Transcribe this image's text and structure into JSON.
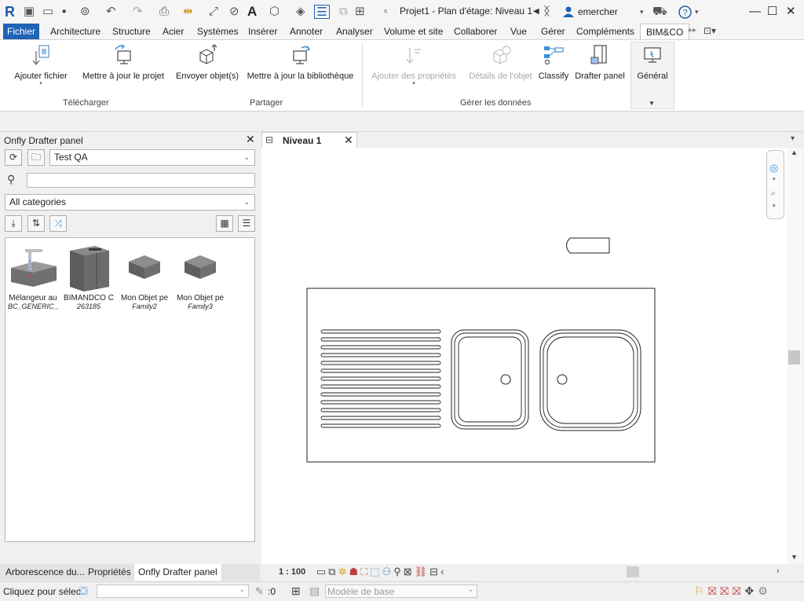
{
  "titlebar": {
    "title": "Projet1 - Plan d'étage: Niveau 1",
    "user": "emercher",
    "text_tool": "A",
    "app_logo": "R"
  },
  "tabs": [
    {
      "label": "Fichier"
    },
    {
      "label": "Architecture"
    },
    {
      "label": "Structure"
    },
    {
      "label": "Acier"
    },
    {
      "label": "Systèmes"
    },
    {
      "label": "Insérer"
    },
    {
      "label": "Annoter"
    },
    {
      "label": "Analyser"
    },
    {
      "label": "Volume et site"
    },
    {
      "label": "Collaborer"
    },
    {
      "label": "Vue"
    },
    {
      "label": "Gérer"
    },
    {
      "label": "Compléments"
    },
    {
      "label": "BIM&CO"
    }
  ],
  "ribbon": {
    "buttons": [
      {
        "label": "Ajouter fichier"
      },
      {
        "label": "Mettre à jour le projet"
      },
      {
        "label": "Envoyer objet(s)"
      },
      {
        "label": "Mettre à jour la bibliothèque"
      },
      {
        "label": "Ajouter des propriétés"
      },
      {
        "label": "Détails de l'objet"
      },
      {
        "label": "Classify"
      },
      {
        "label": "Drafter panel"
      },
      {
        "label": "Général"
      }
    ],
    "groups": [
      {
        "label": "Télécharger"
      },
      {
        "label": "Partager"
      },
      {
        "label": "Gérer les données"
      }
    ]
  },
  "left_panel": {
    "title": "Onfly Drafter panel",
    "close": "✕",
    "project_select": "Test QA",
    "search_value": "",
    "category_select": "All categories",
    "objects": [
      {
        "name": "Mélangeur au",
        "sub": "BC_GENERIC_A"
      },
      {
        "name": "BIMANDCO C",
        "sub": "263185"
      },
      {
        "name": "Mon Objet pe",
        "sub": "Family2"
      },
      {
        "name": "Mon Objet pe",
        "sub": "Family3"
      }
    ],
    "bottom_tabs": [
      {
        "label": "Arborescence du..."
      },
      {
        "label": "Propriétés"
      },
      {
        "label": "Onfly Drafter panel"
      }
    ]
  },
  "view": {
    "tab_label": "Niveau 1",
    "close": "✕",
    "scale": "1 : 100"
  },
  "status": {
    "prompt": "Cliquez pour sélec",
    "count": ":0",
    "model": "Modèle de base"
  },
  "colors": {
    "fichier_tab": "#1e63b4",
    "accent_icon": "#3d8fd8"
  }
}
